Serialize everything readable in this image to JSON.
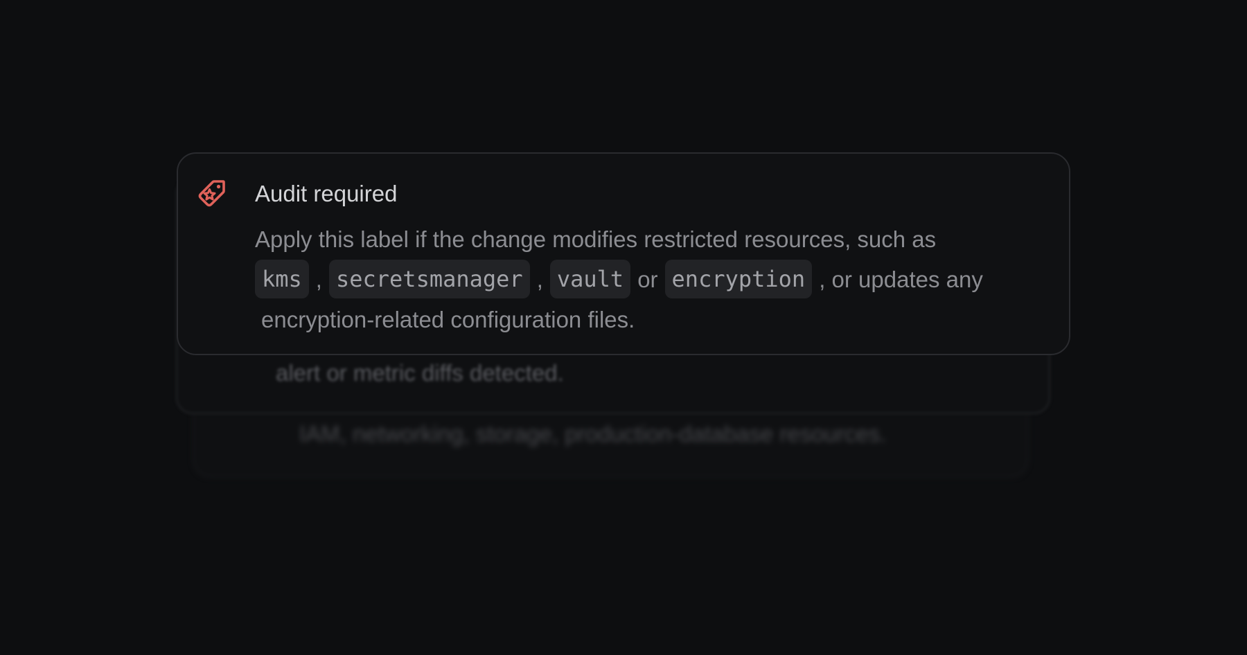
{
  "accent_color": "#e0625a",
  "background_cards": [
    {
      "text": "IAM, networking, storage, production-database resources."
    },
    {
      "text": "alert or metric diffs detected."
    }
  ],
  "label_card": {
    "icon": "tag-icon",
    "title": "Audit required",
    "body_intro": "Apply this label if the change modifies restricted resources, such as",
    "code_terms": [
      "kms",
      "secretsmanager",
      "vault",
      "encryption"
    ],
    "separators": [
      ",",
      ",",
      "or",
      ", or updates any"
    ],
    "body_end": "encryption-related configuration files."
  }
}
